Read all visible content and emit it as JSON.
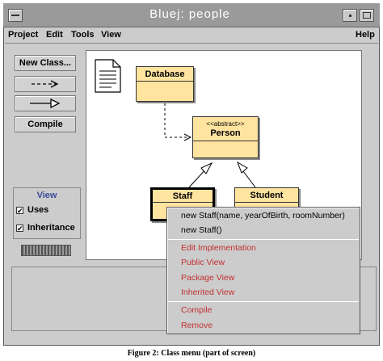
{
  "window": {
    "title": "Bluej:  people"
  },
  "menubar": {
    "project": "Project",
    "edit": "Edit",
    "tools": "Tools",
    "view": "View",
    "help": "Help"
  },
  "toolbar": {
    "new_class": "New Class...",
    "uses_arrow": "- - - >",
    "inherit_arrow": "——▷",
    "compile": "Compile"
  },
  "view_panel": {
    "heading": "View",
    "uses_label": "Uses",
    "uses_checked": true,
    "inheritance_label": "Inheritance",
    "inheritance_checked": true,
    "check_mark": "✔"
  },
  "classes": {
    "database": {
      "name": "Database"
    },
    "person": {
      "stereotype": "<<abstract>>",
      "name": "Person"
    },
    "staff": {
      "name": "Staff"
    },
    "student": {
      "name": "Student"
    }
  },
  "context_menu": {
    "constructor_1": "new Staff(name, yearOfBirth, roomNumber)",
    "constructor_2": "new Staff()",
    "edit_impl": "Edit Implementation",
    "public_view": "Public View",
    "package_view": "Package View",
    "inherited_view": "Inherited View",
    "compile": "Compile",
    "remove": "Remove"
  },
  "caption": "Figure 2: Class menu (part of screen)",
  "colors": {
    "class_fill": "#ffe4a0",
    "menu_red": "#c0302f",
    "title_bar": "#9a9a9a"
  }
}
